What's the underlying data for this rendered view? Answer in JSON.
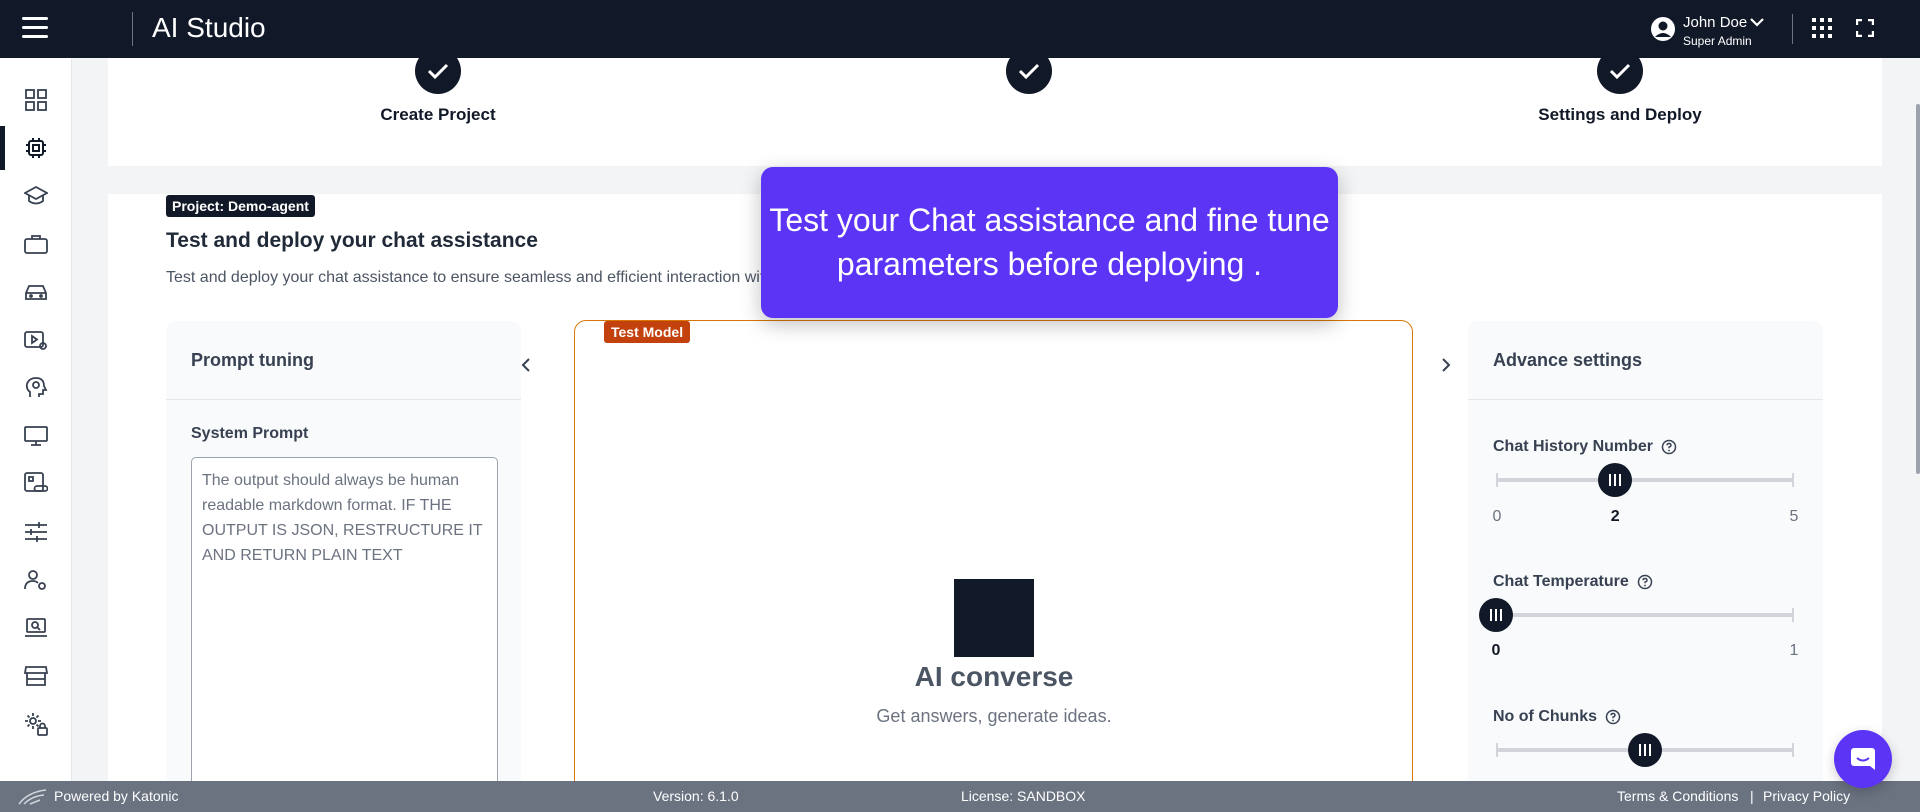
{
  "app": {
    "title": "AI Studio"
  },
  "user": {
    "name": "John Doe",
    "role": "Super Admin"
  },
  "steps": [
    {
      "label": "Create Project",
      "done": true
    },
    {
      "label": "",
      "done": true
    },
    {
      "label": "Settings and Deploy",
      "done": true
    }
  ],
  "project_badge": "Project: Demo-agent",
  "heading": "Test and deploy your chat assistance",
  "description": "Test and deploy your chat assistance to ensure seamless and efficient interaction with users.",
  "tooltip": {
    "text": "Test your Chat assistance and fine tune parameters before deploying ."
  },
  "prompt_tuning": {
    "title": "Prompt tuning",
    "system_prompt_label": "System Prompt",
    "system_prompt_value": "The output should always be human readable markdown format. IF THE OUTPUT IS JSON, RESTRUCTURE IT AND RETURN PLAIN TEXT"
  },
  "test_model": {
    "badge": "Test Model",
    "title": "AI converse",
    "subtitle": "Get answers, generate ideas."
  },
  "advance": {
    "title": "Advance settings",
    "sliders": [
      {
        "label": "Chat History Number",
        "min": "0",
        "max": "5",
        "value": "2",
        "fraction": 0.4
      },
      {
        "label": "Chat Temperature",
        "min": "",
        "max": "1",
        "value": "0",
        "fraction": 0.0
      },
      {
        "label": "No of Chunks",
        "min": "",
        "max": "",
        "value": "",
        "fraction": 0.5
      }
    ]
  },
  "footer": {
    "powered": "Powered by Katonic",
    "version": "Version: 6.1.0",
    "license": "License: SANDBOX",
    "terms": "Terms & Conditions",
    "sep": "|",
    "privacy": "Privacy Policy"
  },
  "icons": {
    "sidebar": [
      "dashboard-icon",
      "chip-icon",
      "graduation-cap-icon",
      "briefcase-icon",
      "car-icon",
      "video-settings-icon",
      "head-gear-icon",
      "monitor-icon",
      "app-link-icon",
      "sliders-icon",
      "user-gear-icon",
      "laptop-search-icon",
      "store-icon",
      "settings-lock-icon"
    ]
  },
  "colors": {
    "navy": "#111827",
    "accent": "#5b34f5",
    "test_border": "#d97706",
    "badge_orange": "#c2410c"
  }
}
